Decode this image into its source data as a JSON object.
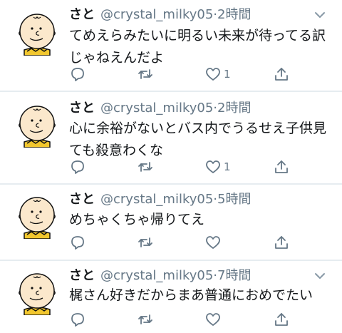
{
  "tweets": [
    {
      "name": "さと",
      "handle": "@crystal_milky05",
      "separator": "·",
      "time": "2時間",
      "text": "てめえらみたいに明るい未来が待ってる訳じゃねえんだよ",
      "reply_count": "",
      "retweet_count": "",
      "like_count": "1"
    },
    {
      "name": "さと",
      "handle": "@crystal_milky05",
      "separator": "·",
      "time": "2時間",
      "text": "心に余裕がないとバス内でうるせえ子供見ても殺意わくな",
      "reply_count": "",
      "retweet_count": "",
      "like_count": "1"
    },
    {
      "name": "さと",
      "handle": "@crystal_milky05",
      "separator": "·",
      "time": "5時間",
      "text": "めちゃくちゃ帰りてえ",
      "reply_count": "",
      "retweet_count": "",
      "like_count": ""
    },
    {
      "name": "さと",
      "handle": "@crystal_milky05",
      "separator": "·",
      "time": "7時間",
      "text": "梶さん好きだからまあ普通におめでたい",
      "reply_count": "",
      "retweet_count": "",
      "like_count": ""
    }
  ],
  "icons": {
    "caret": "chevron-down-icon",
    "reply": "reply-icon",
    "retweet": "retweet-icon",
    "like": "heart-icon",
    "share": "share-icon"
  },
  "colors": {
    "text": "#14171a",
    "secondary": "#657786",
    "separator": "#e6ecf0",
    "avatar_skin": "#fbe8cc",
    "avatar_shirt": "#f2c72e"
  }
}
